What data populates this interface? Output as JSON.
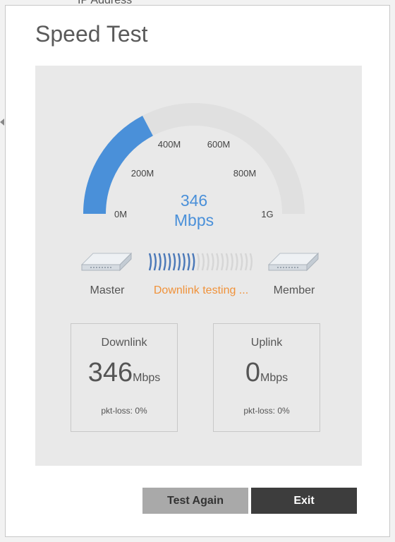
{
  "background": {
    "text": "IP Address"
  },
  "dialog": {
    "title": "Speed Test",
    "gauge": {
      "tick_labels": [
        "0M",
        "200M",
        "400M",
        "600M",
        "800M",
        "1G"
      ],
      "value": 346,
      "max": 1000,
      "value_text": "346",
      "unit_text": "Mbps",
      "fill_color": "#4a90d9",
      "track_color": "#e0e0e0"
    },
    "devices": {
      "left_label": "Master",
      "right_label": "Member",
      "status_text": "Downlink testing ...",
      "progress_fraction": 0.45
    },
    "downlink": {
      "title": "Downlink",
      "value": "346",
      "unit": "Mbps",
      "pkt_loss": "pkt-loss: 0%"
    },
    "uplink": {
      "title": "Uplink",
      "value": "0",
      "unit": "Mbps",
      "pkt_loss": "pkt-loss: 0%"
    },
    "buttons": {
      "test_again": "Test Again",
      "exit": "Exit"
    }
  }
}
